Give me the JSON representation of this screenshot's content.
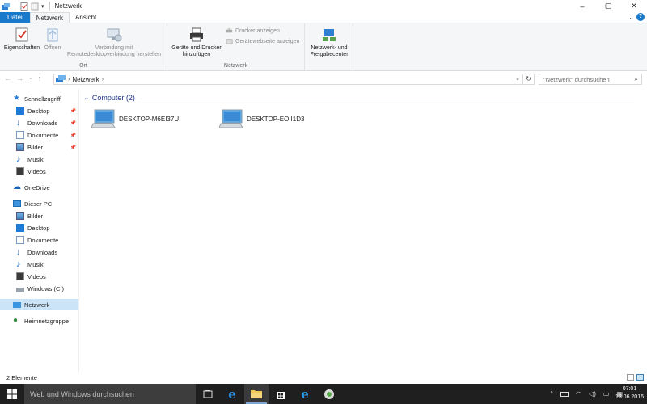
{
  "window": {
    "title": "Netzwerk",
    "minimize_glyph": "–",
    "maximize_glyph": "▢",
    "close_glyph": "✕",
    "help_glyph": "?",
    "ribbon_collapse_glyph": "⌄"
  },
  "ribbon_tabs": [
    {
      "label": "Datei"
    },
    {
      "label": "Netzwerk"
    },
    {
      "label": "Ansicht"
    }
  ],
  "ribbon": {
    "groups": {
      "ort": "Ort",
      "netzwerk": "Netzwerk"
    },
    "properties": "Eigenschaften",
    "open": "Öffnen",
    "remote_desktop_line1": "Verbindung mit",
    "remote_desktop_line2": "Remotedesktopverbindung herstellen",
    "add_devices_line1": "Geräte und Drucker",
    "add_devices_line2": "hinzufügen",
    "show_printers": "Drucker anzeigen",
    "device_webpage": "Gerätewebseite anzeigen",
    "network_center_line1": "Netzwerk- und",
    "network_center_line2": "Freigabecenter"
  },
  "address": {
    "back_glyph": "←",
    "forward_glyph": "→",
    "recent_glyph": "⌄",
    "up_glyph": "↑",
    "location": "Netzwerk",
    "separator": "›",
    "dropdown_glyph": "⌄",
    "refresh_glyph": "↻",
    "search_placeholder": "\"Netzwerk\" durchsuchen",
    "search_glyph": "⌕"
  },
  "nav_pane": {
    "quick_access": "Schnellzugriff",
    "quick_items": [
      {
        "label": "Desktop"
      },
      {
        "label": "Downloads"
      },
      {
        "label": "Dokumente"
      },
      {
        "label": "Bilder"
      },
      {
        "label": "Musik"
      },
      {
        "label": "Videos"
      }
    ],
    "onedrive": "OneDrive",
    "this_pc": "Dieser PC",
    "pc_items": [
      {
        "label": "Bilder"
      },
      {
        "label": "Desktop"
      },
      {
        "label": "Dokumente"
      },
      {
        "label": "Downloads"
      },
      {
        "label": "Musik"
      },
      {
        "label": "Videos"
      },
      {
        "label": "Windows (C:)"
      }
    ],
    "network": "Netzwerk",
    "homegroup": "Heimnetzgruppe"
  },
  "content": {
    "group_header": "Computer (2)",
    "collapse_glyph": "⌄",
    "computers": [
      {
        "name": "DESKTOP-M6EI37U"
      },
      {
        "name": "DESKTOP-EOII1D3"
      }
    ]
  },
  "status_bar": {
    "item_count": "2 Elemente"
  },
  "taskbar": {
    "search_placeholder": "Web und Windows durchsuchen",
    "tray_chevron_glyph": "^",
    "time": "07:01",
    "date": "13.06.2016"
  },
  "colors": {
    "accent": "#1979ca",
    "selection": "#cce4f7",
    "group_header": "#1e3287",
    "taskbar": "#1f1f1f"
  }
}
